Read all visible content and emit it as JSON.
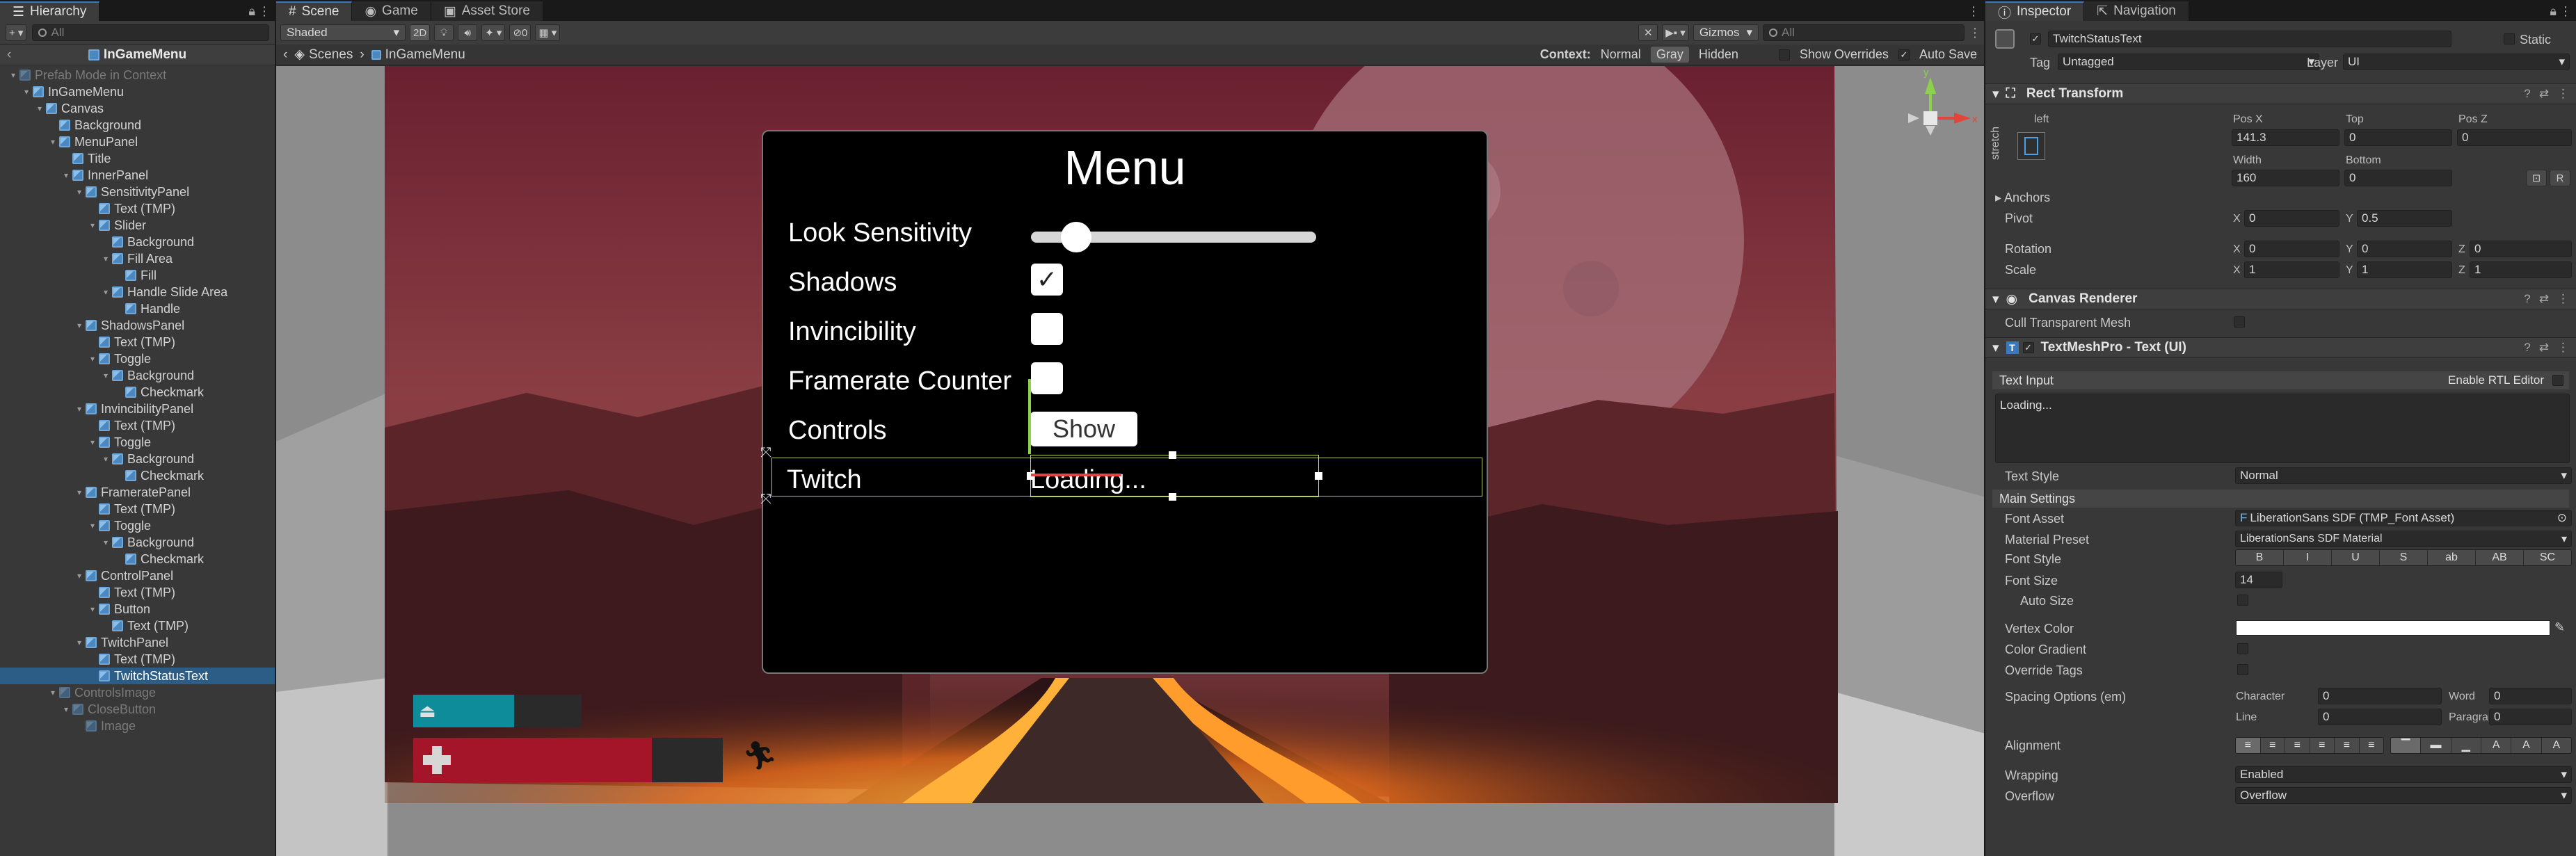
{
  "hierarchy": {
    "tab_label": "Hierarchy",
    "search_placeholder": "All",
    "root_title": "InGameMenu",
    "rows": [
      {
        "label": "Prefab Mode in Context",
        "depth": 1,
        "arrow": "▾",
        "dim": true,
        "sel": false
      },
      {
        "label": "InGameMenu",
        "depth": 2,
        "arrow": "▾",
        "dim": false,
        "sel": false
      },
      {
        "label": "Canvas",
        "depth": 3,
        "arrow": "▾",
        "dim": false,
        "sel": false
      },
      {
        "label": "Background",
        "depth": 4,
        "arrow": "",
        "dim": false,
        "sel": false
      },
      {
        "label": "MenuPanel",
        "depth": 4,
        "arrow": "▾",
        "dim": false,
        "sel": false
      },
      {
        "label": "Title",
        "depth": 5,
        "arrow": "",
        "dim": false,
        "sel": false
      },
      {
        "label": "InnerPanel",
        "depth": 5,
        "arrow": "▾",
        "dim": false,
        "sel": false
      },
      {
        "label": "SensitivityPanel",
        "depth": 6,
        "arrow": "▾",
        "dim": false,
        "sel": false
      },
      {
        "label": "Text (TMP)",
        "depth": 7,
        "arrow": "",
        "dim": false,
        "sel": false
      },
      {
        "label": "Slider",
        "depth": 7,
        "arrow": "▾",
        "dim": false,
        "sel": false
      },
      {
        "label": "Background",
        "depth": 8,
        "arrow": "",
        "dim": false,
        "sel": false
      },
      {
        "label": "Fill Area",
        "depth": 8,
        "arrow": "▾",
        "dim": false,
        "sel": false
      },
      {
        "label": "Fill",
        "depth": 9,
        "arrow": "",
        "dim": false,
        "sel": false
      },
      {
        "label": "Handle Slide Area",
        "depth": 8,
        "arrow": "▾",
        "dim": false,
        "sel": false
      },
      {
        "label": "Handle",
        "depth": 9,
        "arrow": "",
        "dim": false,
        "sel": false
      },
      {
        "label": "ShadowsPanel",
        "depth": 6,
        "arrow": "▾",
        "dim": false,
        "sel": false
      },
      {
        "label": "Text (TMP)",
        "depth": 7,
        "arrow": "",
        "dim": false,
        "sel": false
      },
      {
        "label": "Toggle",
        "depth": 7,
        "arrow": "▾",
        "dim": false,
        "sel": false
      },
      {
        "label": "Background",
        "depth": 8,
        "arrow": "▾",
        "dim": false,
        "sel": false
      },
      {
        "label": "Checkmark",
        "depth": 9,
        "arrow": "",
        "dim": false,
        "sel": false
      },
      {
        "label": "InvincibilityPanel",
        "depth": 6,
        "arrow": "▾",
        "dim": false,
        "sel": false
      },
      {
        "label": "Text (TMP)",
        "depth": 7,
        "arrow": "",
        "dim": false,
        "sel": false
      },
      {
        "label": "Toggle",
        "depth": 7,
        "arrow": "▾",
        "dim": false,
        "sel": false
      },
      {
        "label": "Background",
        "depth": 8,
        "arrow": "▾",
        "dim": false,
        "sel": false
      },
      {
        "label": "Checkmark",
        "depth": 9,
        "arrow": "",
        "dim": false,
        "sel": false
      },
      {
        "label": "FrameratePanel",
        "depth": 6,
        "arrow": "▾",
        "dim": false,
        "sel": false
      },
      {
        "label": "Text (TMP)",
        "depth": 7,
        "arrow": "",
        "dim": false,
        "sel": false
      },
      {
        "label": "Toggle",
        "depth": 7,
        "arrow": "▾",
        "dim": false,
        "sel": false
      },
      {
        "label": "Background",
        "depth": 8,
        "arrow": "▾",
        "dim": false,
        "sel": false
      },
      {
        "label": "Checkmark",
        "depth": 9,
        "arrow": "",
        "dim": false,
        "sel": false
      },
      {
        "label": "ControlPanel",
        "depth": 6,
        "arrow": "▾",
        "dim": false,
        "sel": false
      },
      {
        "label": "Text (TMP)",
        "depth": 7,
        "arrow": "",
        "dim": false,
        "sel": false
      },
      {
        "label": "Button",
        "depth": 7,
        "arrow": "▾",
        "dim": false,
        "sel": false
      },
      {
        "label": "Text (TMP)",
        "depth": 8,
        "arrow": "",
        "dim": false,
        "sel": false
      },
      {
        "label": "TwitchPanel",
        "depth": 6,
        "arrow": "▾",
        "dim": false,
        "sel": false
      },
      {
        "label": "Text (TMP)",
        "depth": 7,
        "arrow": "",
        "dim": false,
        "sel": false
      },
      {
        "label": "TwitchStatusText",
        "depth": 7,
        "arrow": "",
        "dim": false,
        "sel": true
      },
      {
        "label": "ControlsImage",
        "depth": 4,
        "arrow": "▾",
        "dim": true,
        "sel": false
      },
      {
        "label": "CloseButton",
        "depth": 5,
        "arrow": "▾",
        "dim": true,
        "sel": false
      },
      {
        "label": "Image",
        "depth": 6,
        "arrow": "",
        "dim": true,
        "sel": false
      }
    ]
  },
  "scene": {
    "tabs": [
      "Scene",
      "Game",
      "Asset Store"
    ],
    "shading": "Shaded",
    "mode_2d": "2D",
    "gizmos": "Gizmos",
    "search_placeholder": "All",
    "hidden_count": "0",
    "breadcrumb": [
      "Scenes",
      "InGameMenu"
    ],
    "context_label": "Context:",
    "context_options": [
      "Normal",
      "Gray",
      "Hidden"
    ],
    "show_overrides": "Show Overrides",
    "auto_save": "Auto Save",
    "menu": {
      "title": "Menu",
      "rows": [
        "Look Sensitivity",
        "Shadows",
        "Invincibility",
        "Framerate Counter",
        "Controls",
        "Twitch"
      ],
      "slider_value": 0.12,
      "shadows_checked": true,
      "invincibility_checked": false,
      "framerate_checked": false,
      "controls_button": "Show",
      "twitch_status": "Loading..."
    },
    "hud": {
      "teal_bar_fill": 0.6,
      "red_bar_fill": 0.77,
      "teal_color": "#0e8c9a",
      "red_color": "#a5152a"
    },
    "gizmo_axes": {
      "y": "y",
      "x": "x"
    }
  },
  "inspector": {
    "tabs": [
      "Inspector",
      "Navigation"
    ],
    "object_name": "TwitchStatusText",
    "static_label": "Static",
    "tag_label": "Tag",
    "tag_value": "Untagged",
    "layer_label": "Layer",
    "layer_value": "UI",
    "rect_transform": {
      "title": "Rect Transform",
      "anchor_h": "left",
      "anchor_v": "stretch",
      "pos_x_label": "Pos X",
      "pos_x": "141.3",
      "top_label": "Top",
      "top": "0",
      "pos_z_label": "Pos Z",
      "pos_z": "0",
      "width_label": "Width",
      "width": "160",
      "bottom_label": "Bottom",
      "bottom": "0",
      "anchors_label": "Anchors",
      "pivot_label": "Pivot",
      "pivot_x": "0",
      "pivot_y": "0.5",
      "rotation_label": "Rotation",
      "rot_x": "0",
      "rot_y": "0",
      "rot_z": "0",
      "scale_label": "Scale",
      "scale_x": "1",
      "scale_y": "1",
      "scale_z": "1",
      "btn_r": "R"
    },
    "canvas_renderer": {
      "title": "Canvas Renderer",
      "cull_label": "Cull Transparent Mesh"
    },
    "tmp": {
      "title": "TextMeshPro - Text (UI)",
      "text_input_label": "Text Input",
      "rtl_label": "Enable RTL Editor",
      "text_value": "Loading...",
      "text_style_label": "Text Style",
      "text_style_value": "Normal",
      "main_settings": "Main Settings",
      "font_asset_label": "Font Asset",
      "font_asset_value": "LiberationSans SDF (TMP_Font Asset)",
      "material_label": "Material Preset",
      "material_value": "LiberationSans SDF Material",
      "font_style_label": "Font Style",
      "font_style_buttons": [
        "B",
        "I",
        "U",
        "S",
        "ab",
        "AB",
        "SC"
      ],
      "font_size_label": "Font Size",
      "font_size_value": "14",
      "auto_size_label": "Auto Size",
      "vertex_color_label": "Vertex Color",
      "vertex_color": "#ffffff",
      "color_gradient_label": "Color Gradient",
      "override_tags_label": "Override Tags",
      "spacing_label": "Spacing Options (em)",
      "character_label": "Character",
      "character_value": "0",
      "word_label": "Word",
      "word_value": "0",
      "line_label": "Line",
      "line_value": "0",
      "paragraph_label": "Paragraph",
      "paragraph_value": "0",
      "alignment_label": "Alignment",
      "wrapping_label": "Wrapping",
      "wrapping_value": "Enabled",
      "overflow_label": "Overflow",
      "overflow_value": "Overflow"
    }
  }
}
